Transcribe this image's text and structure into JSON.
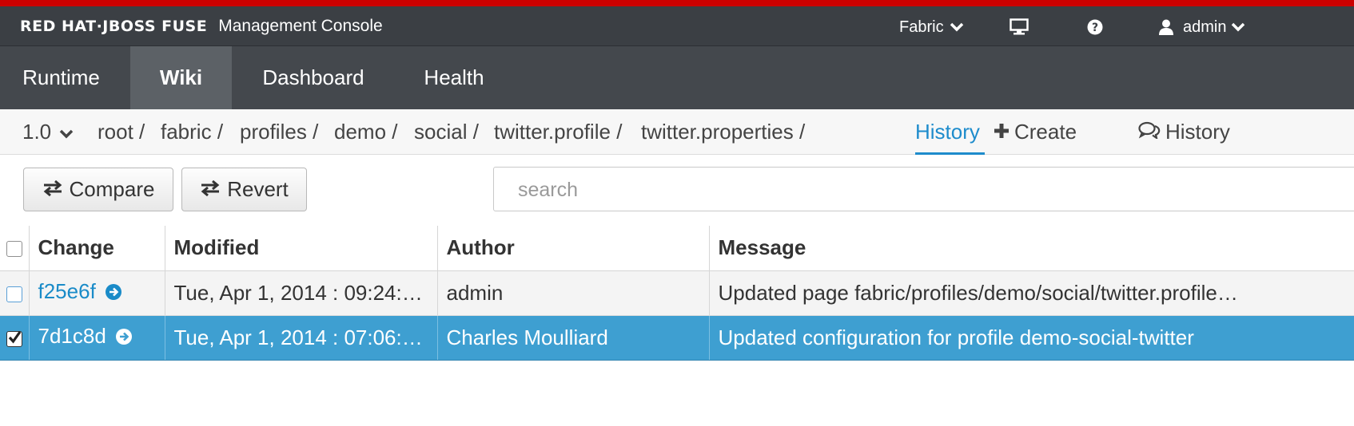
{
  "header": {
    "brand": "RED HAT·JBOSS FUSE",
    "subtitle": "Management Console",
    "fabric_label": "Fabric",
    "user_label": "admin",
    "icons": [
      "monitor-icon",
      "help-icon",
      "user-icon",
      "chevron-down-icon"
    ]
  },
  "nav": {
    "tabs": [
      {
        "label": "Runtime",
        "active": false
      },
      {
        "label": "Wiki",
        "active": true
      },
      {
        "label": "Dashboard",
        "active": false
      },
      {
        "label": "Health",
        "active": false
      }
    ]
  },
  "breadcrumb": {
    "version": "1.0",
    "items": [
      "root",
      "fabric",
      "profiles",
      "demo",
      "social",
      "twitter.profile",
      "twitter.properties"
    ],
    "separator": "/",
    "active": "History",
    "create_label": "Create",
    "history_label": "History"
  },
  "toolbar": {
    "compare_label": "Compare",
    "revert_label": "Revert",
    "search_placeholder": "search"
  },
  "table": {
    "columns": [
      "Change",
      "Modified",
      "Author",
      "Message"
    ],
    "rows": [
      {
        "change": "f25e6f",
        "modified": "Tue, Apr 1, 2014 : 09:24:…",
        "author": "admin",
        "message": "Updated page fabric/profiles/demo/social/twitter.profile…",
        "checked": false,
        "selected": false
      },
      {
        "change": "7d1c8d",
        "modified": "Tue, Apr 1, 2014 : 07:06:…",
        "author": "Charles Moulliard",
        "message": "Updated configuration for profile demo-social-twitter",
        "checked": true,
        "selected": true
      }
    ]
  },
  "colors": {
    "accent_red": "#cc0000",
    "topbar": "#3b3f44",
    "navbar": "#44484d",
    "link_blue": "#1a8bc8",
    "selected_row": "#3e9fd1"
  }
}
